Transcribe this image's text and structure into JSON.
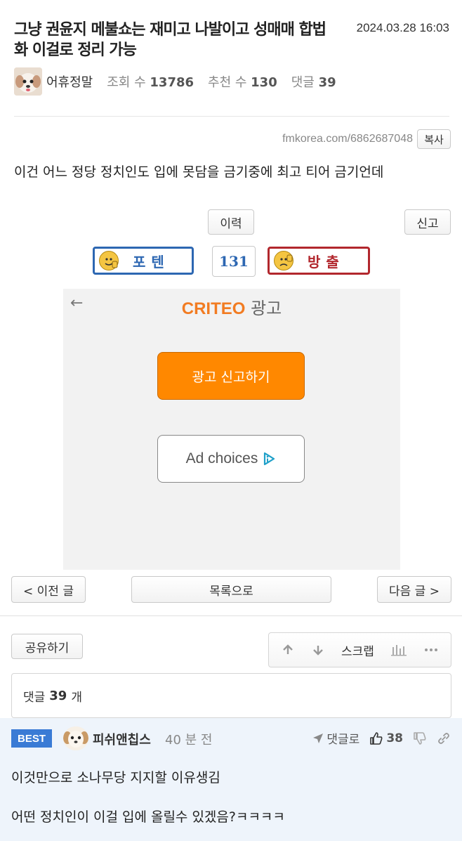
{
  "post": {
    "title": "그냥 권윤지 메불쇼는 재미고 나발이고 성매매 합법화 이걸로 정리 가능",
    "date": "2024.03.28 16:03",
    "author": "어휴정말",
    "views_label": "조회 수",
    "views": "13786",
    "recommend_label": "추천 수",
    "recommend": "130",
    "comments_label": "댓글",
    "comments": "39",
    "url": "fmkorea.com/6862687048",
    "copy_label": "복사",
    "body": "이건 어느 정당 정치인도 입에 못담을 금기중에 최고 티어 금기언데"
  },
  "actions": {
    "history_label": "이력",
    "report_label": "신고",
    "upvote_label": "포텐",
    "downvote_label": "방출",
    "vote_count": "131"
  },
  "ad": {
    "brand": "CRITEO",
    "suffix": "광고",
    "report_label": "광고 신고하기",
    "choices_label": "Ad choices"
  },
  "nav": {
    "prev_label": "< 이전 글",
    "list_label": "목록으로",
    "next_label": "다음 글 >"
  },
  "tools": {
    "share_label": "공유하기",
    "scrap_label": "스크랩"
  },
  "comment_summary": {
    "prefix": "댓글",
    "count": "39",
    "suffix": "개"
  },
  "best_comment": {
    "badge": "BEST",
    "author": "피쉬앤칩스",
    "time": "40 분 전",
    "reply_label": "댓글로",
    "likes": "38",
    "text_line1": "이것만으로 소나무당 지지할 이유생김",
    "text_line2": "어떤 정치인이 이걸 입에 올릴수 있겠음?ㅋㅋㅋㅋ"
  },
  "colors": {
    "upvote": "#2d67b2",
    "downvote": "#b2272d",
    "ad_brand": "#f27c22",
    "ad_button": "#ff8800",
    "best_badge": "#3a7bd5",
    "comment_bg": "#eef4fb"
  }
}
